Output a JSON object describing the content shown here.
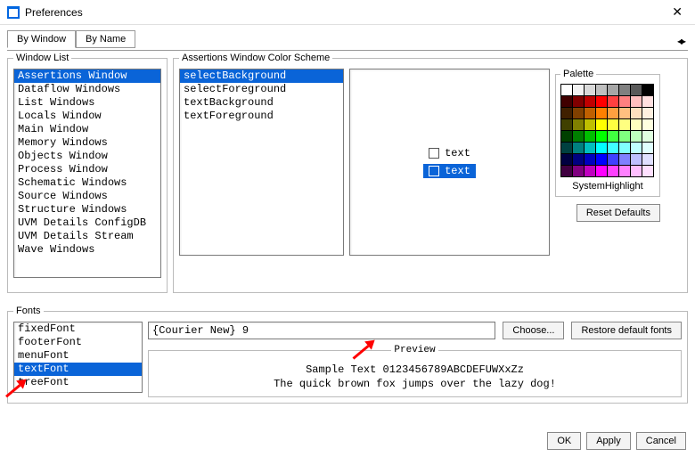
{
  "title": "Preferences",
  "tabs": {
    "by_window": "By Window",
    "by_name": "By Name"
  },
  "window_list": {
    "legend": "Window List",
    "items": [
      "Assertions Window",
      "Dataflow Windows",
      "List Windows",
      "Locals Window",
      "Main Window",
      "Memory Windows",
      "Objects Window",
      "Process Window",
      "Schematic Windows",
      "Source Windows",
      "Structure Windows",
      "UVM Details ConfigDB",
      "UVM Details Stream",
      "Wave Windows"
    ],
    "selected": 0
  },
  "color_scheme": {
    "legend": "Assertions Window Color Scheme",
    "items": [
      "selectBackground",
      "selectForeground",
      "textBackground",
      "textForeground"
    ],
    "selected": 0,
    "preview": {
      "row1": "text",
      "row2": "text"
    },
    "palette_legend": "Palette",
    "palette_label": "SystemHighlight",
    "reset_label": "Reset Defaults",
    "palette_colors": [
      "#ffffff",
      "#f2f2f2",
      "#d9d9d9",
      "#bfbfbf",
      "#a6a6a6",
      "#808080",
      "#595959",
      "#000000",
      "#400000",
      "#800000",
      "#bf0000",
      "#ff0000",
      "#ff4040",
      "#ff8080",
      "#ffbfbf",
      "#ffe0e0",
      "#402000",
      "#804000",
      "#bf6000",
      "#ff8000",
      "#ffa040",
      "#ffc080",
      "#ffe0bf",
      "#fff0e0",
      "#404000",
      "#808000",
      "#bfbf00",
      "#ffff00",
      "#ffff40",
      "#ffff80",
      "#ffffbf",
      "#ffffe0",
      "#004000",
      "#008000",
      "#00bf00",
      "#00ff00",
      "#40ff40",
      "#80ff80",
      "#bfffbf",
      "#e0ffe0",
      "#004040",
      "#008080",
      "#00bfbf",
      "#00ffff",
      "#40ffff",
      "#80ffff",
      "#bfffff",
      "#e0ffff",
      "#000040",
      "#000080",
      "#0000bf",
      "#0000ff",
      "#4040ff",
      "#8080ff",
      "#bfbfff",
      "#e0e0ff",
      "#400040",
      "#800080",
      "#bf00bf",
      "#ff00ff",
      "#ff40ff",
      "#ff80ff",
      "#ffbfff",
      "#ffe0ff"
    ]
  },
  "fonts": {
    "legend": "Fonts",
    "items": [
      "fixedFont",
      "footerFont",
      "menuFont",
      "textFont",
      "treeFont"
    ],
    "selected": 3,
    "value": "{Courier New} 9",
    "choose_label": "Choose...",
    "restore_label": "Restore default fonts",
    "preview_legend": "Preview",
    "preview_line1": "Sample Text 0123456789ABCDEFUWXxZz",
    "preview_line2": "The quick brown fox jumps over the lazy dog!"
  },
  "buttons": {
    "ok": "OK",
    "apply": "Apply",
    "cancel": "Cancel"
  }
}
